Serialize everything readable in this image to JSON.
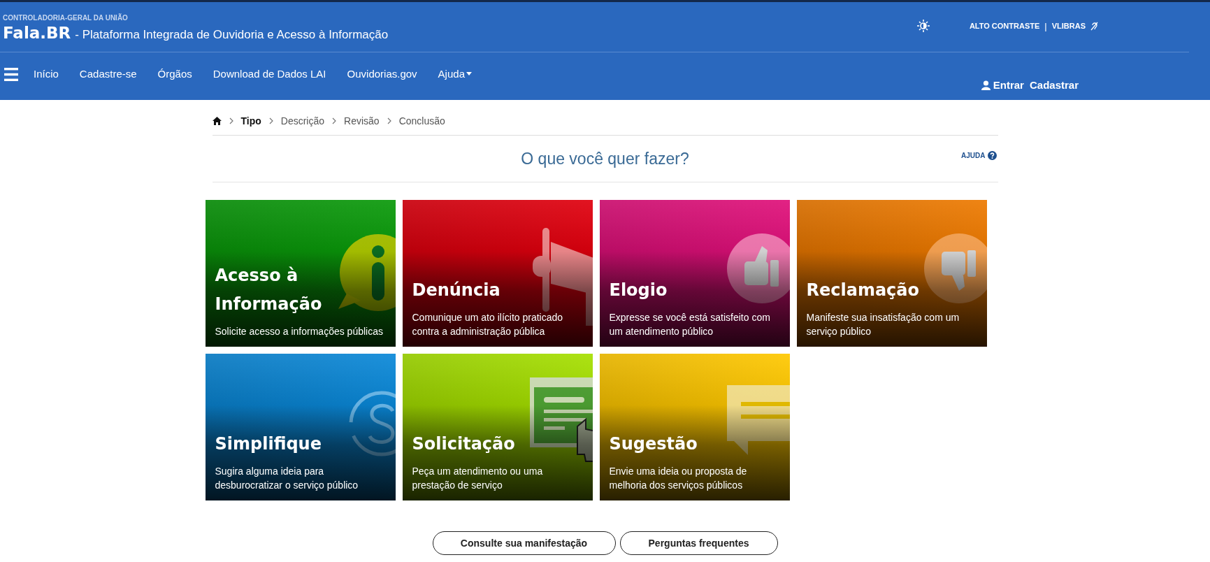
{
  "header": {
    "agency": "CONTROLADORIA-GERAL DA UNIÃO",
    "brand": "Fala.BR",
    "subtitle": "- Plataforma Integrada de Ouvidoria e Acesso à Informação",
    "contrast_label": "ALTO CONTRASTE",
    "separator": "|",
    "vlibras_label": "VLIBRAS"
  },
  "nav": {
    "items": [
      {
        "label": "Início",
        "dropdown": false
      },
      {
        "label": "Cadastre-se",
        "dropdown": false
      },
      {
        "label": "Órgãos",
        "dropdown": false
      },
      {
        "label": "Download de Dados LAI",
        "dropdown": false
      },
      {
        "label": "Ouvidorias.gov",
        "dropdown": false
      },
      {
        "label": "Ajuda",
        "dropdown": true
      }
    ],
    "login": "Entrar",
    "register": "Cadastrar"
  },
  "breadcrumb": [
    {
      "label": "Tipo",
      "selected": true
    },
    {
      "label": "Descrição",
      "selected": false
    },
    {
      "label": "Revisão",
      "selected": false
    },
    {
      "label": "Conclusão",
      "selected": false
    }
  ],
  "heading": "O que você quer fazer?",
  "help_link": "AJUDA",
  "tiles": [
    {
      "kind": "info",
      "title": "Acesso à Informação",
      "description": "Solicite acesso a informações públicas",
      "color": "#0a9a0a"
    },
    {
      "kind": "megaphone",
      "title": "Denúncia",
      "description": "Comunique um ato ilícito praticado contra a administração pública",
      "color": "#e0000e"
    },
    {
      "kind": "thumbs-up",
      "title": "Elogio",
      "description": "Expresse se você está satisfeito com um atendimento público",
      "color": "#e0107a"
    },
    {
      "kind": "thumbs-down",
      "title": "Reclamação",
      "description": "Manifeste sua insatisfação com um serviço público",
      "color": "#ee7a00"
    },
    {
      "kind": "sync",
      "title": "Simplifique",
      "description": "Sugira alguma ideia para desburocratizar o serviço público",
      "color": "#0a88d8"
    },
    {
      "kind": "screen",
      "title": "Solicitação",
      "description": "Peça um atendimento ou uma prestação de serviço",
      "color": "#a6e000"
    },
    {
      "kind": "speech",
      "title": "Sugestão",
      "description": "Envie uma ideia ou proposta de melhoria dos serviços públicos",
      "color": "#ffc800"
    }
  ],
  "buttons": [
    "Consulte sua manifestação",
    "Perguntas frequentes"
  ]
}
